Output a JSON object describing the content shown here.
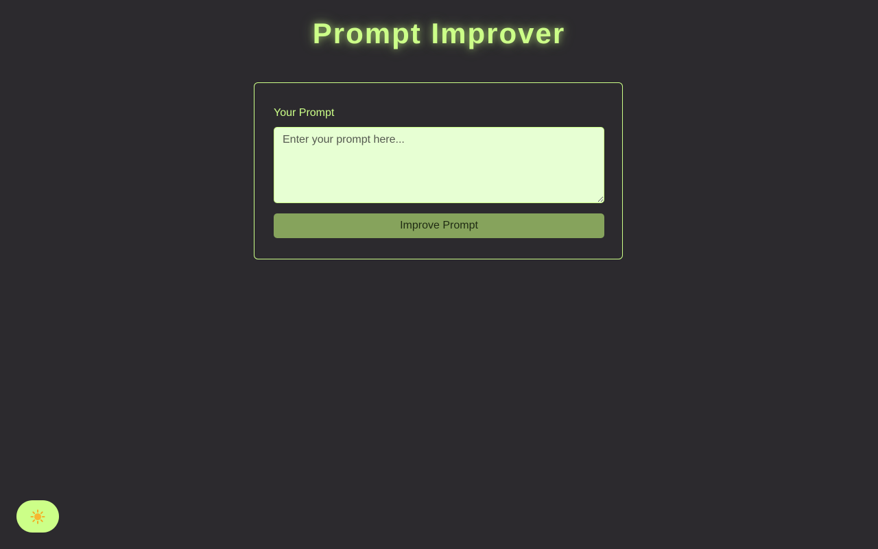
{
  "app": {
    "title": "Prompt Improver"
  },
  "form": {
    "prompt_label": "Your Prompt",
    "prompt_placeholder": "Enter your prompt here...",
    "prompt_value": "",
    "submit_label": "Improve Prompt"
  },
  "theme_toggle": {
    "icon": "sun-icon"
  },
  "colors": {
    "background": "#2c2a2e",
    "accent": "#ccff88",
    "textarea_bg": "#e7ffd3",
    "button_bg": "#86a35c"
  }
}
